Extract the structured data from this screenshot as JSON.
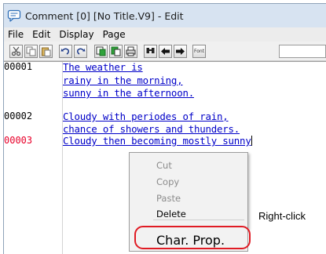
{
  "window": {
    "title": "Comment [0] [No Title.V9] - Edit",
    "icon": "comment-icon"
  },
  "menubar": {
    "items": [
      "File",
      "Edit",
      "Display",
      "Page"
    ]
  },
  "toolbar": {
    "buttons": [
      "cut-icon",
      "copy-icon",
      "paste-icon",
      "undo-icon",
      "redo-icon",
      "insert-icon",
      "replace-icon",
      "print-icon",
      "search-icon",
      "back-arrow-icon",
      "forward-arrow-icon",
      "font-icon"
    ],
    "font_label": "Font"
  },
  "editor": {
    "lines": [
      {
        "number": "00001",
        "active": false,
        "text": "The weather is"
      },
      {
        "number": "",
        "active": false,
        "text": "rainy in the morning,"
      },
      {
        "number": "",
        "active": false,
        "text": "sunny in the afternoon."
      },
      {
        "number": "00002",
        "active": false,
        "text": "Cloudy with periodes of rain,"
      },
      {
        "number": "",
        "active": false,
        "text": "chance of showers and thunders."
      },
      {
        "number": "00003",
        "active": true,
        "text": "Cloudy then becoming mostly sunny"
      }
    ]
  },
  "context_menu": {
    "items": [
      {
        "label": "Cut",
        "enabled": false
      },
      {
        "label": "Copy",
        "enabled": false
      },
      {
        "label": "Paste",
        "enabled": false
      },
      {
        "label": "Delete",
        "enabled": true
      },
      {
        "label": "Char. Prop.",
        "enabled": true
      }
    ]
  },
  "annotation": {
    "label": "Right-click",
    "color": "#e01b24"
  },
  "colors": {
    "text": "#0000c8",
    "active_line_number": "#e8002a",
    "titlebar": "#d7e3f1"
  }
}
